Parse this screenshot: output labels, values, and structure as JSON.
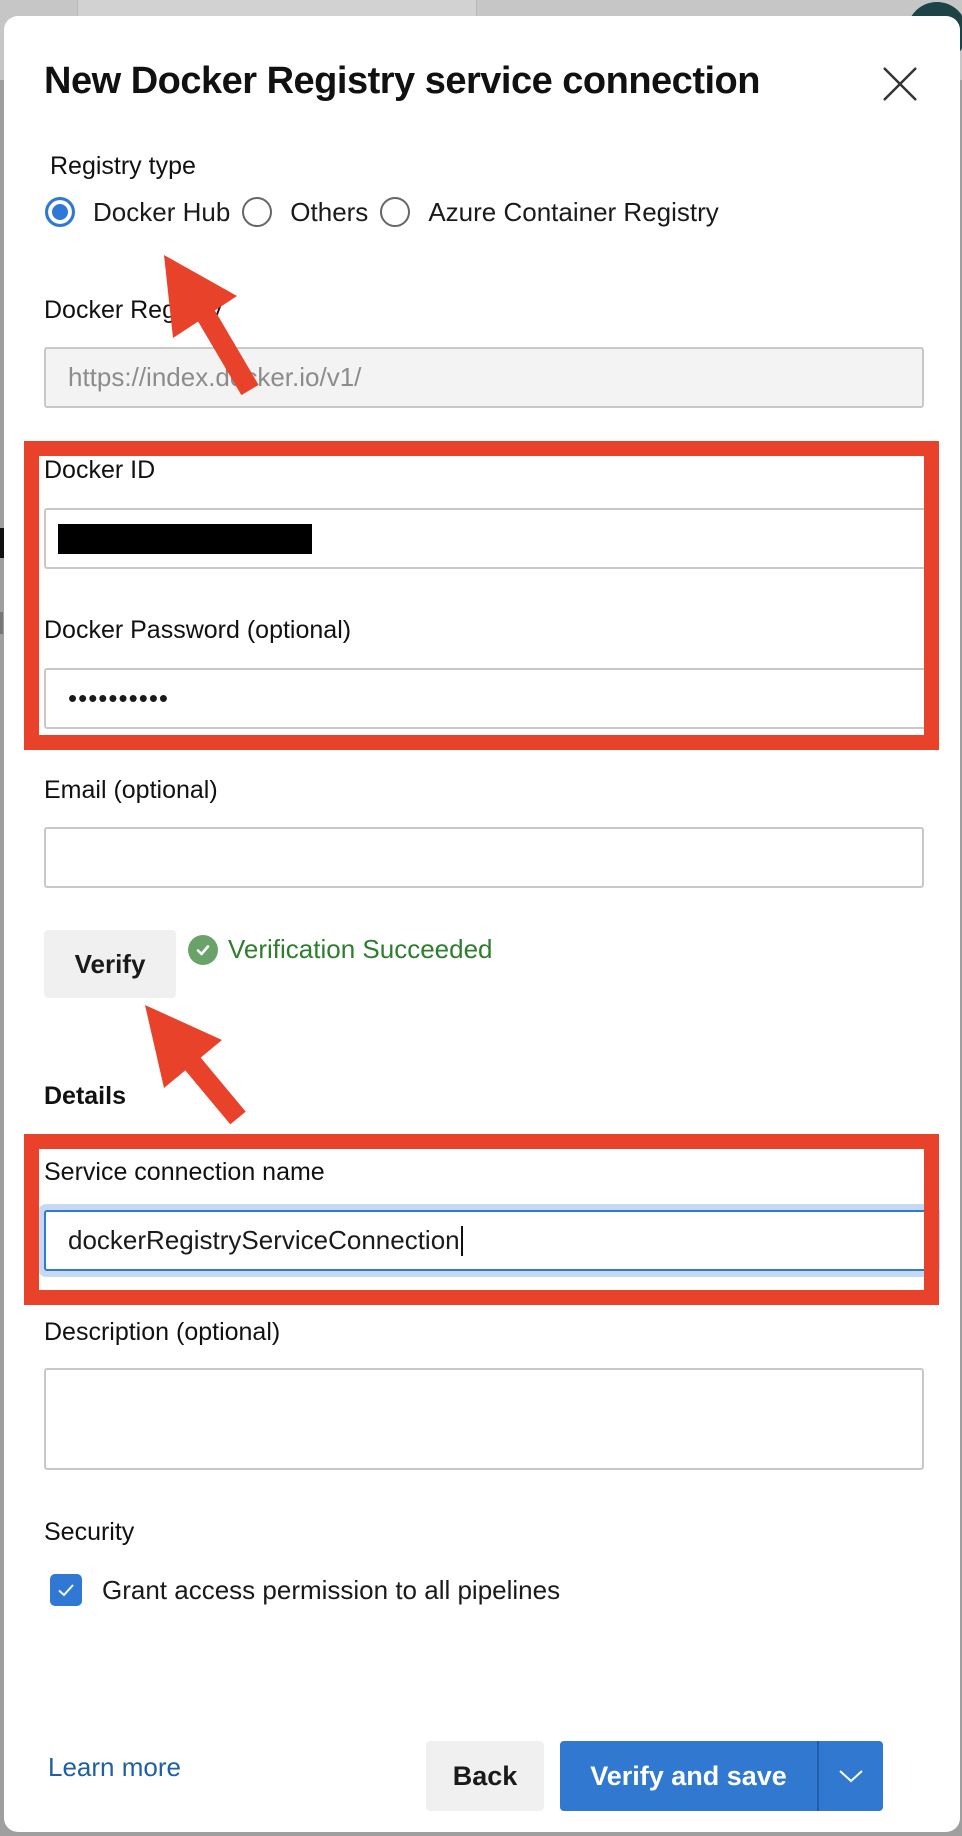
{
  "dialog": {
    "title": "New Docker Registry service connection",
    "close_icon": "close-icon"
  },
  "registry_type": {
    "label": "Registry type",
    "options": [
      {
        "label": "Docker Hub",
        "selected": true
      },
      {
        "label": "Others",
        "selected": false
      },
      {
        "label": "Azure Container Registry",
        "selected": false
      }
    ]
  },
  "docker_registry": {
    "label": "Docker Registry",
    "value": "https://index.docker.io/v1/",
    "disabled": true
  },
  "docker_id": {
    "label": "Docker ID",
    "value_redacted": true
  },
  "docker_password": {
    "label": "Docker Password (optional)",
    "masked_value": "••••••••••"
  },
  "email": {
    "label": "Email (optional)",
    "value": ""
  },
  "verify": {
    "button_label": "Verify",
    "status_text": "Verification Succeeded",
    "status_icon": "check-circle-icon",
    "status_color": "#2f7d2f"
  },
  "details": {
    "heading": "Details",
    "service_connection_name": {
      "label": "Service connection name",
      "value": "dockerRegistryServiceConnection"
    },
    "description": {
      "label": "Description (optional)",
      "value": ""
    }
  },
  "security": {
    "heading": "Security",
    "grant_access": {
      "label": "Grant access permission to all pipelines",
      "checked": true
    }
  },
  "footer": {
    "learn_more": "Learn more",
    "back": "Back",
    "verify_and_save": "Verify and save",
    "dropdown_icon": "chevron-down-icon"
  },
  "colors": {
    "accent": "#3179d0",
    "annotation": "#e8422a",
    "link": "#1f5fa5"
  },
  "annotations": {
    "arrows": [
      "registry-type-docker-hub",
      "verify-button"
    ],
    "highlight_boxes": [
      "docker-credentials",
      "service-connection-name"
    ]
  }
}
